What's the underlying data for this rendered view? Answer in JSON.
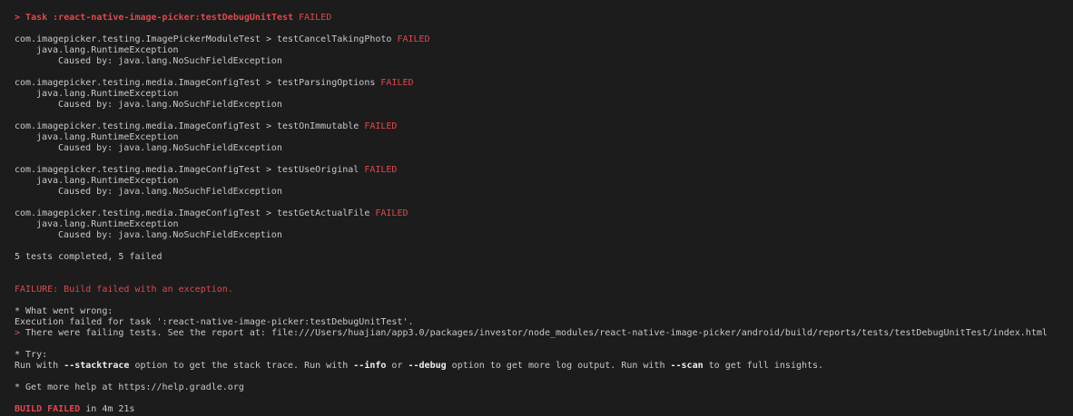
{
  "terminal": {
    "top_cut": "     ───   ──────  ────  ─────  ──── ─────────────   ──────────  ────────   ─────────────────────  ─────   ───────   ──────   ──────────   ──────────   ───────   ────────   ──────   ──────────",
    "task_prefix": "> ",
    "task_name": "Task :react-native-image-picker:testDebugUnitTest",
    "task_status": "FAILED",
    "tests": [
      {
        "class": "com.imagepicker.testing.ImagePickerModuleTest > testCancelTakingPhoto",
        "status": "FAILED",
        "exception": "java.lang.RuntimeException",
        "cause": "Caused by: java.lang.NoSuchFieldException"
      },
      {
        "class": "com.imagepicker.testing.media.ImageConfigTest > testParsingOptions",
        "status": "FAILED",
        "exception": "java.lang.RuntimeException",
        "cause": "Caused by: java.lang.NoSuchFieldException"
      },
      {
        "class": "com.imagepicker.testing.media.ImageConfigTest > testOnImmutable",
        "status": "FAILED",
        "exception": "java.lang.RuntimeException",
        "cause": "Caused by: java.lang.NoSuchFieldException"
      },
      {
        "class": "com.imagepicker.testing.media.ImageConfigTest > testUseOriginal",
        "status": "FAILED",
        "exception": "java.lang.RuntimeException",
        "cause": "Caused by: java.lang.NoSuchFieldException"
      },
      {
        "class": "com.imagepicker.testing.media.ImageConfigTest > testGetActualFile",
        "status": "FAILED",
        "exception": "java.lang.RuntimeException",
        "cause": "Caused by: java.lang.NoSuchFieldException"
      }
    ],
    "summary": "5 tests completed, 5 failed",
    "failure": "FAILURE: Build failed with an exception.",
    "what_went_wrong_header": "* What went wrong:",
    "what_went_wrong_detail": "Execution failed for task ':react-native-image-picker:testDebugUnitTest'.",
    "report_prefix": "> ",
    "report_text": "There were failing tests. See the report at: file:///Users/huajian/app3.0/packages/investor/node_modules/react-native-image-picker/android/build/reports/tests/testDebugUnitTest/index.html",
    "try_header": "* Try:",
    "try_parts": {
      "p1": "Run with ",
      "stacktrace": "--stacktrace",
      "p2": " option to get the stack trace. Run with ",
      "info": "--info",
      "p3": " or ",
      "debug": "--debug",
      "p4": " option to get more log output. Run with ",
      "scan": "--scan",
      "p5": " to get full insights."
    },
    "help": "* Get more help at https://help.gradle.org",
    "build_failed": "BUILD FAILED",
    "build_time": " in 4m 21s"
  }
}
